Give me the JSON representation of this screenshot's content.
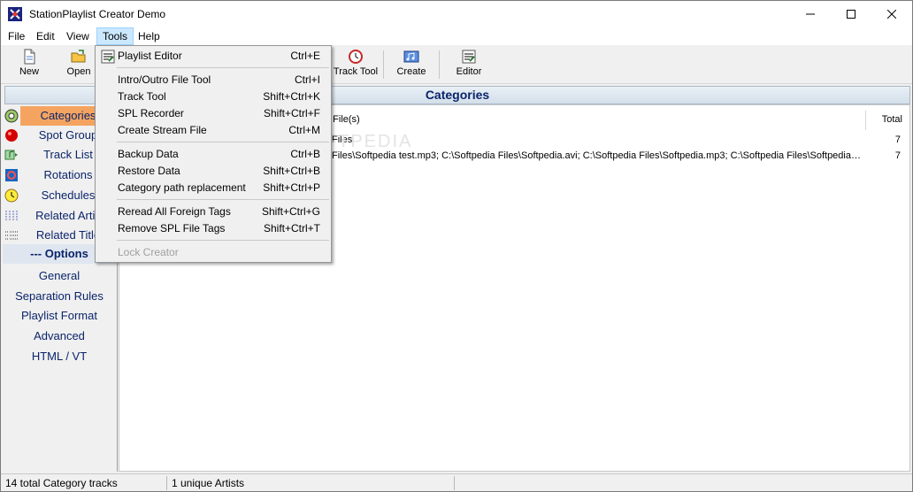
{
  "window": {
    "title": "StationPlaylist Creator Demo"
  },
  "menu": [
    "File",
    "Edit",
    "View",
    "Tools",
    "Help"
  ],
  "toolbar": {
    "new": "New",
    "open": "Open",
    "track_tool": "Track Tool",
    "create": "Create",
    "editor": "Editor"
  },
  "header": {
    "title": "Categories"
  },
  "sidebar": {
    "items": [
      "Categories",
      "Spot Group",
      "Track List",
      "Rotations",
      "Schedules",
      "Related Artis",
      "Related Title"
    ],
    "options_title": "--- Options",
    "options": [
      "General",
      "Separation Rules",
      "Playlist Format",
      "Advanced",
      "HTML / VT"
    ]
  },
  "table": {
    "col_files": "d File(s)",
    "col_total": "Total",
    "rows": [
      {
        "files": "Files",
        "total": "7"
      },
      {
        "files": "Files\\Softpedia test.mp3; C:\\Softpedia Files\\Softpedia.avi; C:\\Softpedia Files\\Softpedia.mp3; C:\\Softpedia Files\\Softpedia.....",
        "total": "7"
      }
    ]
  },
  "watermark": "SOFTPEDIA",
  "tools_menu": {
    "items": [
      {
        "label": "Playlist Editor",
        "shortcut": "Ctrl+E"
      },
      {
        "label": "Intro/Outro File Tool",
        "shortcut": "Ctrl+I"
      },
      {
        "label": "Track Tool",
        "shortcut": "Shift+Ctrl+K"
      },
      {
        "label": "SPL Recorder",
        "shortcut": "Shift+Ctrl+F"
      },
      {
        "label": "Create Stream File",
        "shortcut": "Ctrl+M"
      },
      {
        "label": "Backup Data",
        "shortcut": "Ctrl+B"
      },
      {
        "label": "Restore Data",
        "shortcut": "Shift+Ctrl+B"
      },
      {
        "label": "Category path replacement",
        "shortcut": "Shift+Ctrl+P"
      },
      {
        "label": "Reread All Foreign Tags",
        "shortcut": "Shift+Ctrl+G"
      },
      {
        "label": "Remove SPL File Tags",
        "shortcut": "Shift+Ctrl+T"
      },
      {
        "label": "Lock Creator",
        "shortcut": ""
      }
    ]
  },
  "status": {
    "tracks": "14 total Category tracks",
    "artists": "1 unique Artists"
  },
  "colors": {
    "accent_selected": "#f4a460",
    "link_text": "#0a246a",
    "menu_highlight": "#cce8ff"
  }
}
